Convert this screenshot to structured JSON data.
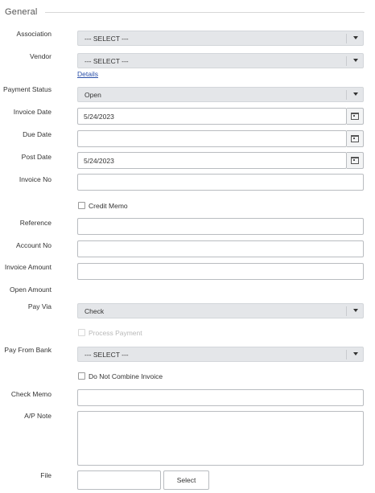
{
  "section": {
    "title": "General"
  },
  "labels": {
    "association": "Association",
    "vendor": "Vendor",
    "payment_status": "Payment Status",
    "invoice_date": "Invoice Date",
    "due_date": "Due Date",
    "post_date": "Post Date",
    "invoice_no": "Invoice No",
    "reference": "Reference",
    "account_no": "Account No",
    "invoice_amount": "Invoice Amount",
    "open_amount": "Open Amount",
    "pay_via": "Pay Via",
    "pay_from_bank": "Pay From Bank",
    "check_memo": "Check Memo",
    "ap_note": "A/P Note",
    "file": "File"
  },
  "fields": {
    "association": "--- SELECT ---",
    "vendor": "--- SELECT ---",
    "vendor_details_link": "Details",
    "payment_status": "Open",
    "invoice_date": "5/24/2023",
    "due_date": "",
    "post_date": "5/24/2023",
    "invoice_no": "",
    "reference": "",
    "account_no": "",
    "invoice_amount": "",
    "pay_via": "Check",
    "pay_from_bank": "--- SELECT ---",
    "check_memo": "",
    "ap_note": "",
    "file": ""
  },
  "checkboxes": {
    "credit_memo": {
      "label": "Credit Memo",
      "checked": false
    },
    "process_payment": {
      "label": "Process Payment",
      "checked": false,
      "disabled": true
    },
    "do_not_combine": {
      "label": "Do Not Combine Invoice",
      "checked": false
    }
  },
  "buttons": {
    "select_file": "Select"
  },
  "icons": {
    "dropdown": "chevron-down-icon",
    "calendar": "calendar-icon"
  }
}
